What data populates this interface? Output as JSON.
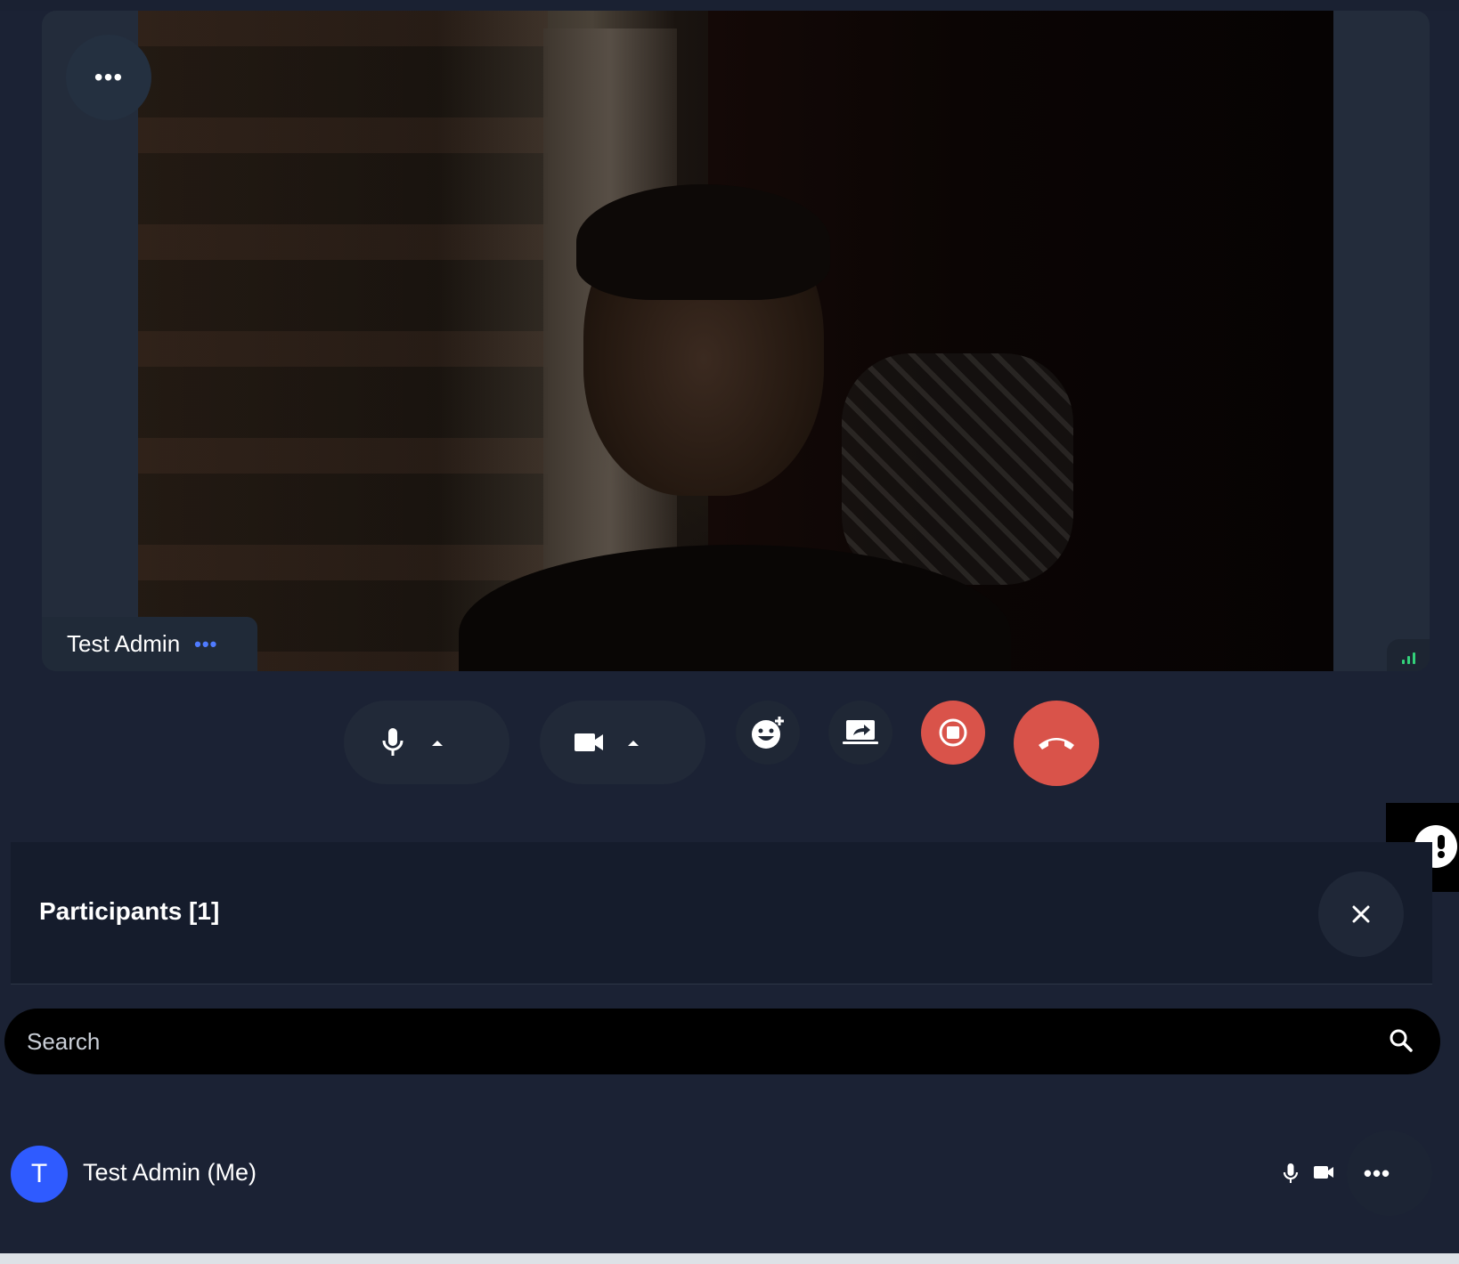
{
  "video": {
    "participant_name": "Test Admin",
    "tile_menu_label": "•••",
    "name_menu_label": "•••",
    "signal_icon": "signal-bars-icon"
  },
  "controls": {
    "mic_icon": "microphone-icon",
    "camera_icon": "video-camera-icon",
    "reactions_icon": "emoji-add-icon",
    "share_icon": "screen-share-icon",
    "record_icon": "stop-recording-icon",
    "end_call_icon": "hang-up-icon",
    "colors": {
      "danger": "#d9534a",
      "pill": "#212938"
    }
  },
  "feedback": {
    "icon": "feedback-chat-icon"
  },
  "participants_panel": {
    "title": "Participants [1]",
    "close_icon": "close-icon",
    "search_placeholder": "Search",
    "list": [
      {
        "initial": "T",
        "name": "Test Admin (Me)",
        "more_label": "•••",
        "avatar_color": "#2f5bff"
      }
    ]
  }
}
